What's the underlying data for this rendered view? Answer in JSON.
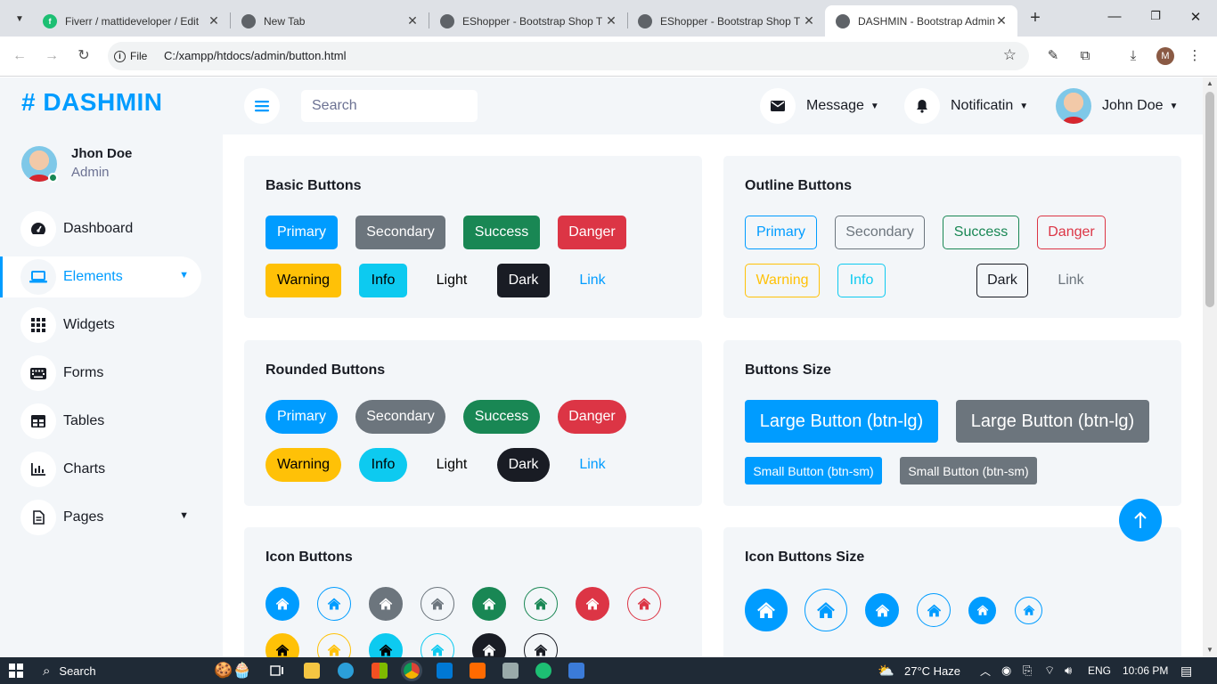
{
  "browser": {
    "tabs": [
      {
        "title": "Fiverr / mattideveloper / Edit",
        "favicon": "fiverr-icon",
        "fav_text": "f",
        "fav_color": "#1dbf73"
      },
      {
        "title": "New Tab",
        "favicon": "chrome-icon",
        "fav_text": "",
        "fav_color": "#5f6368"
      },
      {
        "title": "EShopper - Bootstrap Shop T",
        "favicon": "globe-icon",
        "fav_text": "",
        "fav_color": "#5f6368"
      },
      {
        "title": "EShopper - Bootstrap Shop T",
        "favicon": "globe-icon",
        "fav_text": "",
        "fav_color": "#5f6368"
      },
      {
        "title": "DASHMIN - Bootstrap Admin",
        "favicon": "globe-icon",
        "fav_text": "",
        "fav_color": "#5f6368"
      }
    ],
    "active_tab": 4,
    "file_chip": "File",
    "url": "C:/xampp/htdocs/admin/button.html",
    "profile_initial": "M"
  },
  "sidebar": {
    "brand": "# DASHMIN",
    "user_name": "Jhon Doe",
    "user_role": "Admin",
    "items": [
      {
        "label": "Dashboard",
        "icon": "tachometer-icon",
        "glyph": "◔"
      },
      {
        "label": "Elements",
        "icon": "laptop-icon",
        "glyph": "💻",
        "active": true,
        "dropdown": true
      },
      {
        "label": "Widgets",
        "icon": "th-icon",
        "glyph": "▦"
      },
      {
        "label": "Forms",
        "icon": "keyboard-icon",
        "glyph": "⌨"
      },
      {
        "label": "Tables",
        "icon": "table-icon",
        "glyph": "▤"
      },
      {
        "label": "Charts",
        "icon": "chart-bar-icon",
        "glyph": "📊"
      },
      {
        "label": "Pages",
        "icon": "file-icon",
        "glyph": "🗎",
        "dropdown": true
      }
    ]
  },
  "topbar": {
    "search_placeholder": "Search",
    "message": "Message",
    "notification": "Notificatin",
    "user": "John Doe"
  },
  "cards": {
    "basic": {
      "title": "Basic Buttons",
      "buttons": [
        "Primary",
        "Secondary",
        "Success",
        "Danger",
        "Warning",
        "Info",
        "Light",
        "Dark",
        "Link"
      ]
    },
    "outline": {
      "title": "Outline Buttons",
      "buttons": [
        "Primary",
        "Secondary",
        "Success",
        "Danger",
        "Warning",
        "Info",
        "Dark",
        "Link"
      ]
    },
    "rounded": {
      "title": "Rounded Buttons",
      "buttons": [
        "Primary",
        "Secondary",
        "Success",
        "Danger",
        "Warning",
        "Info",
        "Light",
        "Dark",
        "Link"
      ]
    },
    "sizes": {
      "title": "Buttons Size",
      "large_primary": "Large Button (btn-lg)",
      "large_secondary": "Large Button (btn-lg)",
      "small_primary": "Small Button (btn-sm)",
      "small_secondary": "Small Button (btn-sm)"
    },
    "icon": {
      "title": "Icon Buttons"
    },
    "icon_size": {
      "title": "Icon Buttons Size"
    }
  },
  "colors": {
    "primary": "#009cff",
    "secondary": "#6c757d",
    "success": "#198754",
    "danger": "#dc3545",
    "warning": "#ffc107",
    "info": "#0dcaf0",
    "dark": "#191c24"
  },
  "taskbar": {
    "search": "Search",
    "weather": "27°C  Haze",
    "lang": "ENG",
    "time": "10:06 PM"
  }
}
